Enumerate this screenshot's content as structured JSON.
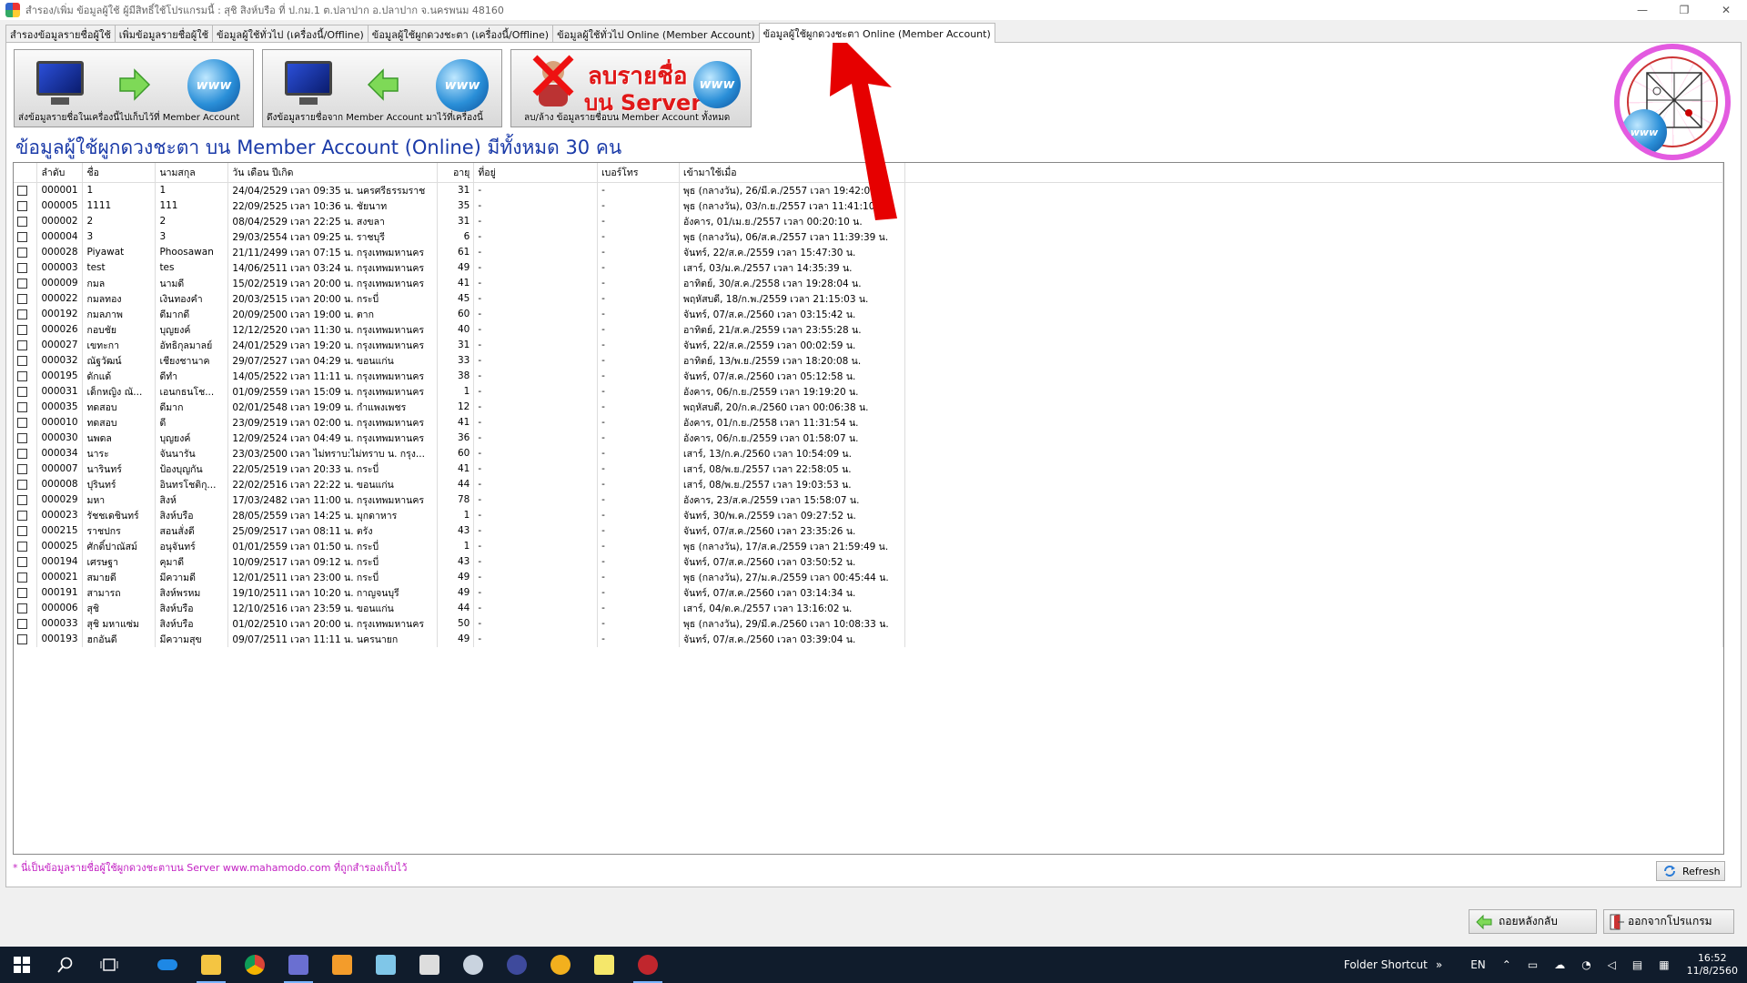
{
  "window": {
    "title": "สำรอง/เพิ่ม ข้อมูลผู้ใช้ ผู้มีสิทธิ์ใช้โปรแกรมนี้ : สุชิ  สิงห์บรือ     ที่ ป.กม.1 ต.ปลาปาก อ.ปลาปาก จ.นครพนม 48160",
    "minimize": "—",
    "maximize": "❐",
    "close": "✕"
  },
  "tabs": [
    {
      "label": "สำรองข้อมูลรายชื่อผู้ใช้",
      "active": false
    },
    {
      "label": "เพิ่มข้อมูลรายชื่อผู้ใช้",
      "active": false
    },
    {
      "label": "ข้อมูลผู้ใช้ทั่วไป (เครื่องนี้/Offline)",
      "active": false
    },
    {
      "label": "ข้อมูลผู้ใช้ผูกดวงชะตา (เครื่องนี้/Offline)",
      "active": false
    },
    {
      "label": "ข้อมูลผู้ใช้ทั่วไป Online (Member Account)",
      "active": false
    },
    {
      "label": "ข้อมูลผู้ใช้ผูกดวงชะตา Online (Member Account)",
      "active": true
    }
  ],
  "actions": {
    "upload_label": "ส่งข้อมูลรายชื่อในเครื่องนี้ไปเก็บไว้ที่ Member Account",
    "download_label": "ดึงข้อมูลรายชื่อจาก Member Account มาไว้ที่เครื่องนี้",
    "delete_label": "ลบ/ล้าง ข้อมูลรายชื่อบน Member Account ทั้งหมด",
    "delete_title_1": "ลบรายชื่อ",
    "delete_title_2": "บน Server",
    "www": "www"
  },
  "heading": "ข้อมูลผู้ใช้ผูกดวงชะตา บน Member Account (Online)  มีทั้งหมด 30 คน",
  "table": {
    "columns": [
      "",
      "ลำดับ",
      "ชื่อ",
      "นามสกุล",
      "วัน เดือน ปีเกิด",
      "อายุ",
      "ที่อยู่",
      "เบอร์โทร",
      "เข้ามาใช้เมื่อ"
    ],
    "rows": [
      [
        "000001",
        "1",
        "1",
        "24/04/2529 เวลา 09:35 น. นครศรีธรรมราช",
        "31",
        "-",
        "-",
        "พุธ (กลางวัน), 26/มี.ค./2557 เวลา 19:42:07 น."
      ],
      [
        "000005",
        "1111",
        "111",
        "22/09/2525 เวลา 10:36 น. ชัยนาท",
        "35",
        "-",
        "-",
        "พุธ (กลางวัน), 03/ก.ย./2557 เวลา 11:41:10 น."
      ],
      [
        "000002",
        "2",
        "2",
        "08/04/2529 เวลา 22:25 น. สงขลา",
        "31",
        "-",
        "-",
        "อังคาร, 01/เม.ย./2557 เวลา 00:20:10 น."
      ],
      [
        "000004",
        "3",
        "3",
        "29/03/2554 เวลา 09:25 น. ราชบุรี",
        "6",
        "-",
        "-",
        "พุธ (กลางวัน), 06/ส.ค./2557 เวลา 11:39:39 น."
      ],
      [
        "000028",
        "Piyawat",
        "Phoosawan",
        "21/11/2499 เวลา 07:15 น. กรุงเทพมหานคร",
        "61",
        "-",
        "-",
        "จันทร์, 22/ส.ค./2559 เวลา 15:47:30 น."
      ],
      [
        "000003",
        "test",
        "tes",
        "14/06/2511 เวลา 03:24 น. กรุงเทพมหานคร",
        "49",
        "-",
        "-",
        "เสาร์, 03/ม.ค./2557 เวลา 14:35:39 น."
      ],
      [
        "000009",
        "กมล",
        "นามดี",
        "15/02/2519 เวลา 20:00 น. กรุงเทพมหานคร",
        "41",
        "-",
        "-",
        "อาทิตย์, 30/ส.ค./2558 เวลา 19:28:04 น."
      ],
      [
        "000022",
        "กมลทอง",
        "เงินทองคำ",
        "20/03/2515 เวลา 20:00 น. กระบี่",
        "45",
        "-",
        "-",
        "พฤหัสบดี, 18/ก.พ./2559 เวลา 21:15:03 น."
      ],
      [
        "000192",
        "กมลภาพ",
        "ดีมากดี",
        "20/09/2500 เวลา 19:00 น. ตาก",
        "60",
        "-",
        "-",
        "จันทร์, 07/ส.ค./2560 เวลา 03:15:42 น."
      ],
      [
        "000026",
        "กอบชัย",
        "บุญยงค์",
        "12/12/2520 เวลา 11:30 น. กรุงเทพมหานคร",
        "40",
        "-",
        "-",
        "อาทิตย์, 21/ส.ค./2559 เวลา 23:55:28 น."
      ],
      [
        "000027",
        "เขทะกา",
        "อัทธิกุลมาลย์",
        "24/01/2529 เวลา 19:20 น. กรุงเทพมหานคร",
        "31",
        "-",
        "-",
        "จันทร์, 22/ส.ค./2559 เวลา 00:02:59 น."
      ],
      [
        "000032",
        "ณัฐวัฒน์",
        "เชียงชานาค",
        "29/07/2527 เวลา 04:29 น. ขอนแก่น",
        "33",
        "-",
        "-",
        "อาทิตย์, 13/พ.ย./2559 เวลา 18:20:08 น."
      ],
      [
        "000195",
        "ดักแด้",
        "ดีทำ",
        "14/05/2522 เวลา 11:11 น. กรุงเทพมหานคร",
        "38",
        "-",
        "-",
        "จันทร์, 07/ส.ค./2560 เวลา 05:12:58 น."
      ],
      [
        "000031",
        "เด็กหญิง ณั...",
        "เอนกธนโช...",
        "01/09/2559 เวลา 15:09 น. กรุงเทพมหานคร",
        "1",
        "-",
        "-",
        "อังคาร, 06/ก.ย./2559 เวลา 19:19:20 น."
      ],
      [
        "000035",
        "ทดสอบ",
        "ดีมาก",
        "02/01/2548 เวลา 19:09 น. กำแพงเพชร",
        "12",
        "-",
        "-",
        "พฤหัสบดี, 20/ก.ค./2560 เวลา 00:06:38 น."
      ],
      [
        "000010",
        "ทดสอบ",
        "ดี",
        "23/09/2519 เวลา 02:00 น. กรุงเทพมหานคร",
        "41",
        "-",
        "-",
        "อังคาร, 01/ก.ย./2558 เวลา 11:31:54 น."
      ],
      [
        "000030",
        "นพดล",
        "บุญยงค์",
        "12/09/2524 เวลา 04:49 น. กรุงเทพมหานคร",
        "36",
        "-",
        "-",
        "อังคาร, 06/ก.ย./2559 เวลา 01:58:07 น."
      ],
      [
        "000034",
        "นาระ",
        "จันนารัน",
        "23/03/2500 เวลา ไม่ทราบ:ไม่ทราบ น. กรุง...",
        "60",
        "-",
        "-",
        "เสาร์, 13/ก.ค./2560 เวลา 10:54:09 น."
      ],
      [
        "000007",
        "นารินทร์",
        "ป้องบุญกัน",
        "22/05/2519 เวลา 20:33 น. กระบี่",
        "41",
        "-",
        "-",
        "เสาร์, 08/พ.ย./2557 เวลา 22:58:05 น."
      ],
      [
        "000008",
        "ปุรินทร์",
        "อินทรโชติกุ...",
        "22/02/2516 เวลา 22:22 น. ขอนแก่น",
        "44",
        "-",
        "-",
        "เสาร์, 08/พ.ย./2557 เวลา 19:03:53 น."
      ],
      [
        "000029",
        "มหา",
        "สิงห์",
        "17/03/2482 เวลา 11:00 น. กรุงเทพมหานคร",
        "78",
        "-",
        "-",
        "อังคาร, 23/ส.ค./2559 เวลา 15:58:07 น."
      ],
      [
        "000023",
        "รัชชเดชินทร์",
        "สิงห์บรือ",
        "28/05/2559 เวลา 14:25 น. มุกดาหาร",
        "1",
        "-",
        "-",
        "จันทร์, 30/พ.ค./2559 เวลา 09:27:52 น."
      ],
      [
        "000215",
        "ราชปกร",
        "สอนสั่งดี",
        "25/09/2517 เวลา 08:11 น. ตรัง",
        "43",
        "-",
        "-",
        "จันทร์, 07/ส.ค./2560 เวลา 23:35:26 น."
      ],
      [
        "000025",
        "ศักดิ์ปาณัสม์",
        "อนุจันทร์",
        "01/01/2559 เวลา 01:50 น. กระบี่",
        "1",
        "-",
        "-",
        "พุธ (กลางวัน), 17/ส.ค./2559 เวลา 21:59:49 น."
      ],
      [
        "000194",
        "เศรษฐา",
        "คุมาดี",
        "10/09/2517 เวลา 09:12 น. กระบี่",
        "43",
        "-",
        "-",
        "จันทร์, 07/ส.ค./2560 เวลา 03:50:52 น."
      ],
      [
        "000021",
        "สมายดี",
        "มีความดี",
        "12/01/2511 เวลา 23:00 น. กระบี่",
        "49",
        "-",
        "-",
        "พุธ (กลางวัน), 27/ม.ค./2559 เวลา 00:45:44 น."
      ],
      [
        "000191",
        "สามารถ",
        "สิงห์พรหม",
        "19/10/2511 เวลา 10:20 น. กาญจนบุรี",
        "49",
        "-",
        "-",
        "จันทร์, 07/ส.ค./2560 เวลา 03:14:34 น."
      ],
      [
        "000006",
        "สุชิ",
        "สิงห์บรือ",
        "12/10/2516 เวลา 23:59 น. ขอนแก่น",
        "44",
        "-",
        "-",
        "เสาร์, 04/ต.ค./2557 เวลา 13:16:02 น."
      ],
      [
        "000033",
        "สุชิ มหาแซ่ม",
        "สิงห์บรือ",
        "01/02/2510 เวลา 20:00 น. กรุงเทพมหานคร",
        "50",
        "-",
        "-",
        "พุธ (กลางวัน), 29/มี.ค./2560 เวลา 10:08:33 น."
      ],
      [
        "000193",
        "ฮกอันดี",
        "มีความสุข",
        "09/07/2511 เวลา 11:11 น. นครนายก",
        "49",
        "-",
        "-",
        "จันทร์, 07/ส.ค./2560 เวลา 03:39:04 น."
      ]
    ]
  },
  "footnote": "* นี่เป็นข้อมูลรายชื่อผู้ใช้ผูกดวงชะตาบน Server www.mahamodo.com ที่ถูกสำรองเก็บไว้",
  "buttons": {
    "refresh": "Refresh",
    "back": "ถอยหลังกลับ",
    "exit": "ออกจากโปรแกรม"
  },
  "taskbar": {
    "folder_shortcut": "Folder Shortcut",
    "chevrons": "»",
    "lang": "EN",
    "time": "16:52",
    "date": "11/8/2560"
  },
  "colors": {
    "heading": "#1a3aa8",
    "footnote": "#c21fc2",
    "annotation_arrow": "#e60000",
    "taskbar": "#101c2c"
  }
}
